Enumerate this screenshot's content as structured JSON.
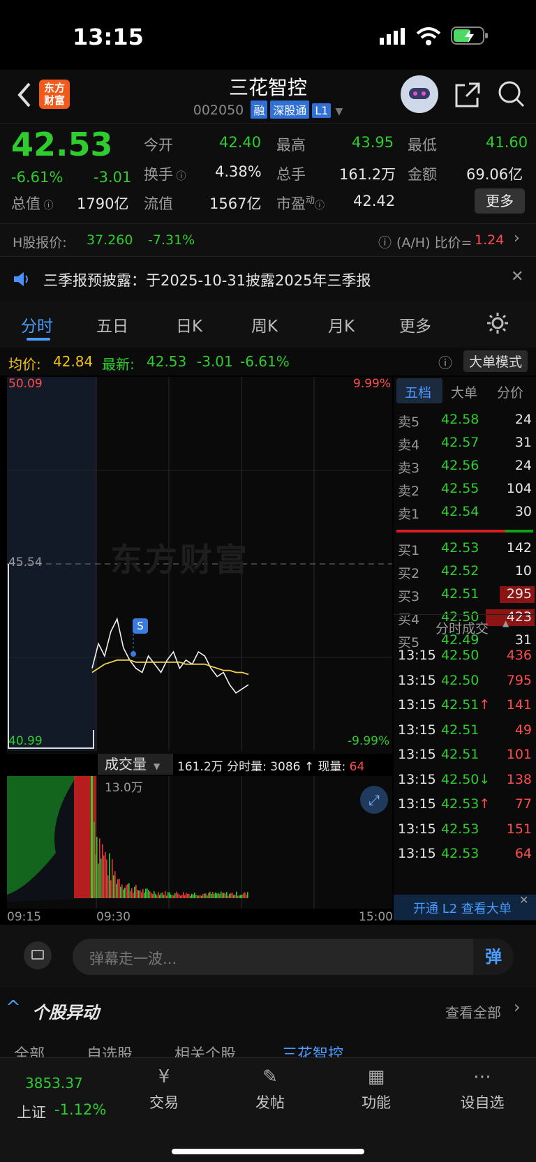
{
  "status_bar": {
    "time": "13:15"
  },
  "header": {
    "stock_name": "三花智控",
    "code": "002050",
    "tags": [
      "融",
      "深股通",
      "L1"
    ],
    "logo_text": "东方财富"
  },
  "quote": {
    "price": "42.53",
    "change_pct": "-6.61%",
    "change": "-3.01",
    "open_label": "今开",
    "open": "42.40",
    "high_label": "最高",
    "high": "43.95",
    "low_label": "最低",
    "low": "41.60",
    "turnover_label": "换手",
    "turnover": "4.38%",
    "volume_label": "总手",
    "volume": "161.2万",
    "amount_label": "金额",
    "amount": "69.06亿",
    "mktcap_label": "总值",
    "mktcap": "1790亿",
    "float_label": "流值",
    "float": "1567亿",
    "pe_label": "市盈",
    "pe_sup": "动",
    "pe": "42.42",
    "more_button": "更多"
  },
  "h_share": {
    "label": "H股报价:",
    "price": "37.260",
    "change": "-7.31%",
    "ah_label": "(A/H) 比价=",
    "ah_value": "1.24"
  },
  "notice": {
    "text": "三季报预披露：于2025-10-31披露2025年三季报"
  },
  "tabs": [
    "分时",
    "五日",
    "日K",
    "周K",
    "月K",
    "更多"
  ],
  "avg_row": {
    "avg_label": "均价:",
    "avg": "42.84",
    "latest_label": "最新:",
    "latest": "42.53",
    "chg": "-3.01",
    "pct": "-6.61%",
    "big_mode": "大单模式"
  },
  "chart": {
    "y_top": "50.09",
    "y_mid": "45.54",
    "y_bot": "40.99",
    "pct_top": "9.99%",
    "pct_bot": "-9.99%",
    "watermark": "东方财富",
    "marker": "S",
    "x_labels": [
      "09:15",
      "09:30",
      "15:00"
    ],
    "vol_label": "成交量",
    "vol_info": "161.2万 分时量: 3086 ↑ 现量:",
    "vol_now": "64",
    "vol_max": "13.0万"
  },
  "chart_data": {
    "type": "line",
    "xlabel": "",
    "ylabel": "",
    "ylim": [
      40.99,
      50.09
    ],
    "x_ticks": [
      "09:15",
      "09:30",
      "15:00"
    ],
    "series": [
      {
        "name": "最新",
        "values": [
          43.0,
          43.6,
          43.3,
          43.9,
          44.2,
          43.5,
          43.2,
          43.0,
          42.9,
          43.3,
          43.1,
          42.9,
          43.2,
          43.4,
          43.0,
          43.2,
          43.1,
          43.4,
          43.3,
          43.0,
          42.8,
          42.9,
          42.6,
          42.4,
          42.5,
          42.6
        ]
      },
      {
        "name": "均价",
        "values": [
          42.9,
          43.0,
          43.1,
          43.15,
          43.2,
          43.2,
          43.2,
          43.15,
          43.15,
          43.15,
          43.15,
          43.15,
          43.15,
          43.15,
          43.15,
          43.1,
          43.1,
          43.1,
          43.1,
          43.05,
          43.0,
          42.95,
          42.95,
          42.9,
          42.9,
          42.85
        ]
      }
    ]
  },
  "book": {
    "tabs": [
      "五档",
      "大单",
      "分价"
    ],
    "asks": [
      {
        "label": "卖5",
        "price": "42.58",
        "vol": "24"
      },
      {
        "label": "卖4",
        "price": "42.57",
        "vol": "31"
      },
      {
        "label": "卖3",
        "price": "42.56",
        "vol": "24"
      },
      {
        "label": "卖2",
        "price": "42.55",
        "vol": "104"
      },
      {
        "label": "卖1",
        "price": "42.54",
        "vol": "30"
      }
    ],
    "bids": [
      {
        "label": "买1",
        "price": "42.53",
        "vol": "142"
      },
      {
        "label": "买2",
        "price": "42.52",
        "vol": "10"
      },
      {
        "label": "买3",
        "price": "42.51",
        "vol": "295"
      },
      {
        "label": "买4",
        "price": "42.50",
        "vol": "423"
      },
      {
        "label": "买5",
        "price": "42.49",
        "vol": "31"
      }
    ],
    "trades_title": "分时成交",
    "trades": [
      {
        "t": "13:15",
        "p": "42.50",
        "v": "436",
        "arrow": ""
      },
      {
        "t": "13:15",
        "p": "42.50",
        "v": "795",
        "arrow": ""
      },
      {
        "t": "13:15",
        "p": "42.51",
        "v": "141",
        "arrow": "↑"
      },
      {
        "t": "13:15",
        "p": "42.51",
        "v": "49",
        "arrow": ""
      },
      {
        "t": "13:15",
        "p": "42.51",
        "v": "101",
        "arrow": ""
      },
      {
        "t": "13:15",
        "p": "42.50",
        "v": "138",
        "arrow": "↓"
      },
      {
        "t": "13:15",
        "p": "42.53",
        "v": "77",
        "arrow": "↑"
      },
      {
        "t": "13:15",
        "p": "42.53",
        "v": "151",
        "arrow": ""
      },
      {
        "t": "13:15",
        "p": "42.53",
        "v": "64",
        "arrow": ""
      }
    ],
    "l2_banner": "开通 L2 查看大单"
  },
  "danmu": {
    "placeholder": "弹幕走一波...",
    "button": "弹"
  },
  "anomaly": {
    "title": "个股异动",
    "view_all": "查看全部",
    "tabs": [
      "全部",
      "自选股",
      "相关个股",
      "三花智控"
    ]
  },
  "bottom_nav": {
    "index_value": "3853.37",
    "index_name": "上证",
    "index_pct": "-1.12%",
    "items": [
      "交易",
      "发帖",
      "功能",
      "设自选"
    ]
  }
}
